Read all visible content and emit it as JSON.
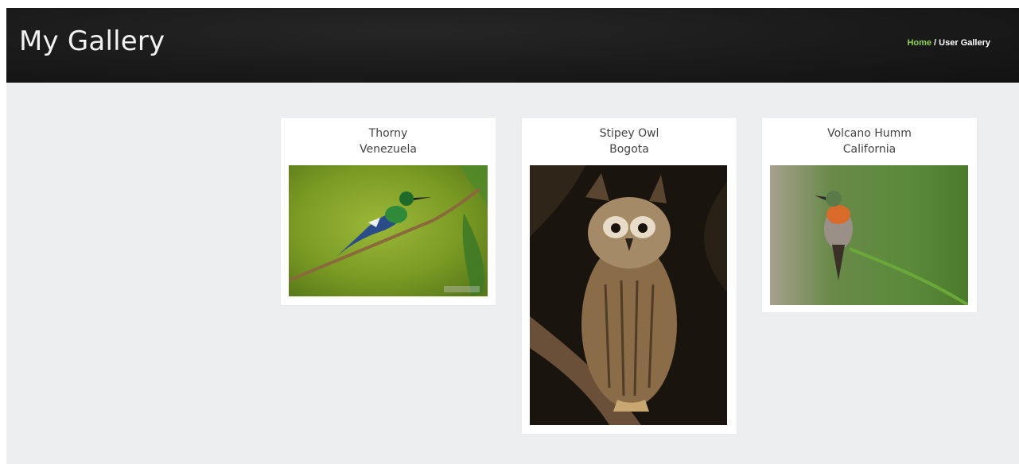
{
  "header": {
    "title": "My Gallery",
    "breadcrumb": {
      "home": "Home",
      "separator": " / ",
      "current": "User Gallery"
    }
  },
  "gallery": [
    {
      "title": "Thorny",
      "location": "Venezuela",
      "subject": "green-hummingbird-on-branch"
    },
    {
      "title": "Stipey Owl",
      "location": "Bogota",
      "subject": "striped-owl-on-branch"
    },
    {
      "title": "Volcano Humm",
      "location": "California",
      "subject": "orange-throated-hummingbird-on-stem"
    }
  ],
  "colors": {
    "header_bg": "#1a1a1a",
    "page_bg": "#eceeef",
    "link_green": "#8fd14f"
  }
}
